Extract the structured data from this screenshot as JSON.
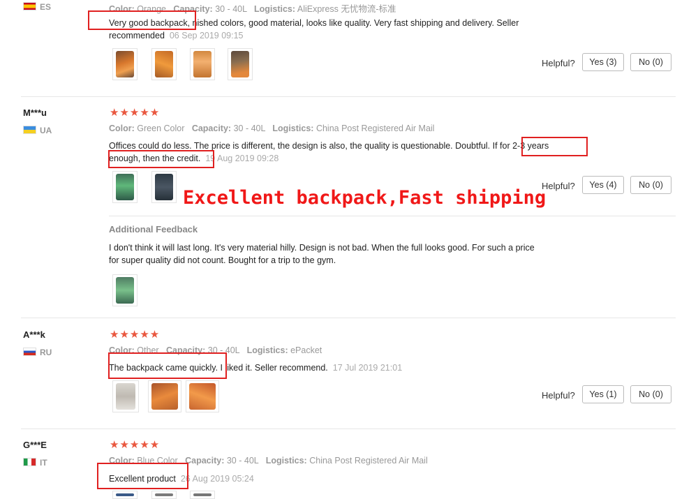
{
  "helpful_label": "Helpful?",
  "overlay_text": "Excellent backpack,Fast shipping",
  "reviews": [
    {
      "country": "ES",
      "color_label": "Color:",
      "color": "Orange",
      "capacity_label": "Capacity:",
      "capacity": "30 - 40L",
      "logistics_label": "Logistics:",
      "logistics": "AliExpress 无忧物流-标准",
      "text_line1": "Very good backpack, nished colors, good material, looks like quality. Very fast shipping and delivery. Seller",
      "text_line2": "recommended",
      "date": "06 Sep 2019 09:15",
      "yes": "Yes (3)",
      "no": "No (0)"
    },
    {
      "user": "M***u",
      "country": "UA",
      "stars": "★★★★★",
      "color_label": "Color:",
      "color": "Green Color",
      "capacity_label": "Capacity:",
      "capacity": "30 - 40L",
      "logistics_label": "Logistics:",
      "logistics": "China Post Registered Air Mail",
      "text_line1": "Offices could do less. The price is different, the design is also, the quality is questionable. Doubtful. If for 2-3 years",
      "text_line2": "enough, then the credit.",
      "date": "19 Aug 2019 09:28",
      "yes": "Yes (4)",
      "no": "No (0)",
      "additional_title": "Additional Feedback",
      "additional_line1": "I don't think it will last long. It's very material hilly. Design is not bad. When the full looks good. For such a price",
      "additional_line2": "for super quality did not count. Bought for a trip to the gym."
    },
    {
      "user": "A***k",
      "country": "RU",
      "stars": "★★★★★",
      "color_label": "Color:",
      "color": "Other",
      "capacity_label": "Capacity:",
      "capacity": "30 - 40L",
      "logistics_label": "Logistics:",
      "logistics": "ePacket",
      "text_line1": "The backpack came quickly. I liked it. Seller recommend.",
      "date": "17 Jul 2019 21:01",
      "yes": "Yes (1)",
      "no": "No (0)"
    },
    {
      "user": "G***E",
      "country": "IT",
      "stars": "★★★★★",
      "color_label": "Color:",
      "color": "Blue Color",
      "capacity_label": "Capacity:",
      "capacity": "30 - 40L",
      "logistics_label": "Logistics:",
      "logistics": "China Post Registered Air Mail",
      "text_line1": "Excellent product",
      "date": "26 Aug 2019 05:24"
    }
  ],
  "icons": {
    "star": "star-icon",
    "flag": "country-flag-icon"
  }
}
